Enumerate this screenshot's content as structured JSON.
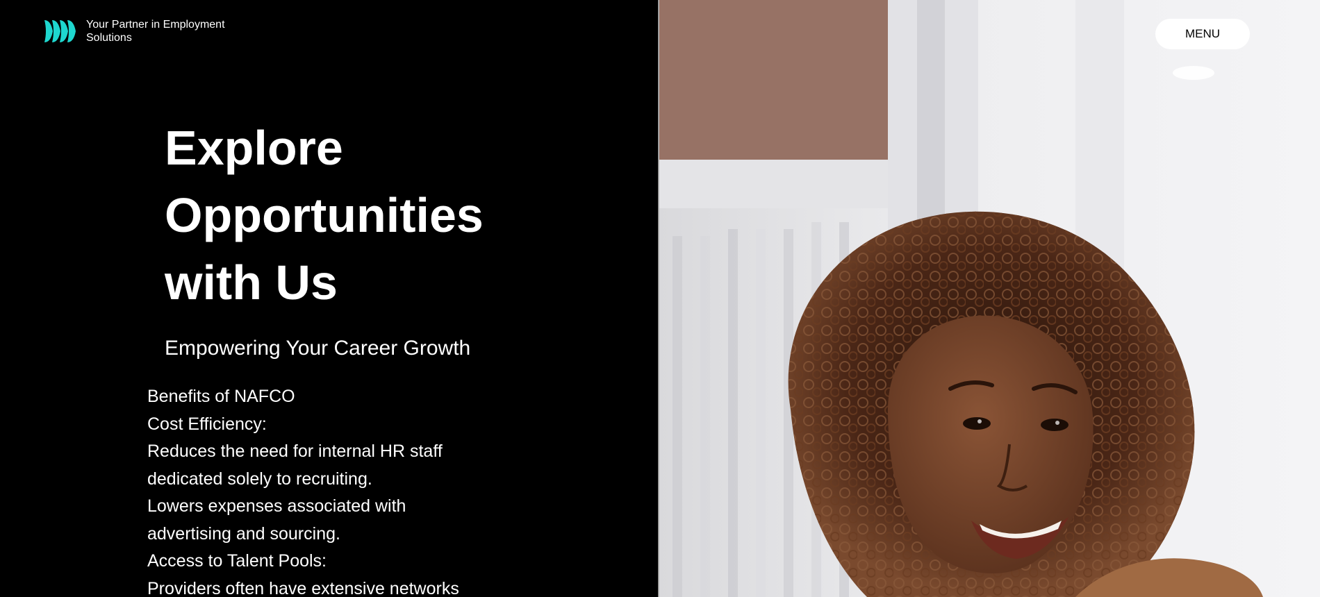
{
  "header": {
    "tagline": "Your Partner in Employment Solutions",
    "logo_icon": "logo-chevrons-icon",
    "logo_color": "#1ed7cf",
    "menu_label": "MENU"
  },
  "hero": {
    "title": "Explore Opportunities with Us",
    "subtitle": "Empowering Your Career Growth",
    "image_icon": "smiling-woman-photo"
  },
  "benefits": {
    "heading": "Benefits of NAFCO",
    "lines": [
      "Cost Efficiency:",
      "Reduces the need for internal HR staff dedicated solely to recruiting.",
      "Lowers expenses associated with advertising and sourcing.",
      "Access to Talent Pools:",
      "Providers often have extensive networks"
    ]
  },
  "colors": {
    "background": "#000000",
    "text": "#ffffff",
    "accent": "#1ed7cf",
    "button_bg": "#ffffff"
  }
}
